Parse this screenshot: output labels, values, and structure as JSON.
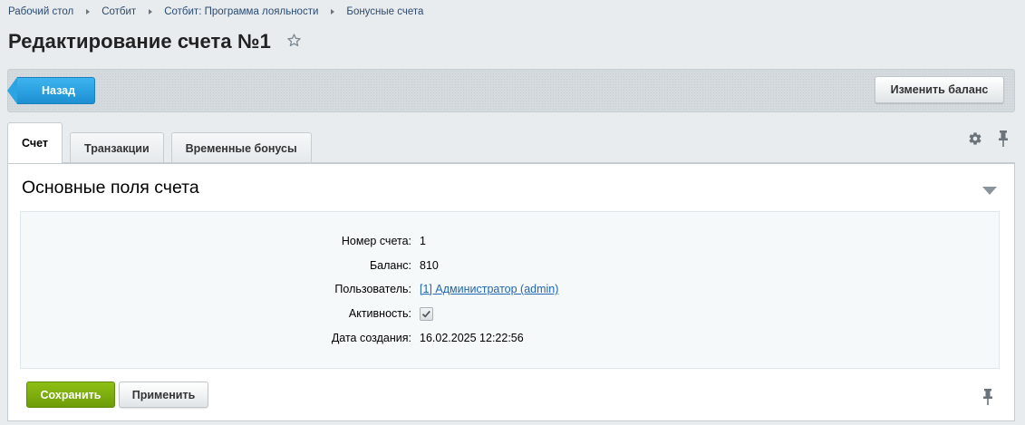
{
  "breadcrumb": [
    {
      "label": "Рабочий стол"
    },
    {
      "label": "Сотбит"
    },
    {
      "label": "Сотбит: Программа лояльности"
    },
    {
      "label": "Бонусные счета"
    }
  ],
  "page": {
    "title": "Редактирование счета №1",
    "favorite_icon": "star-icon"
  },
  "toolbar": {
    "back_label": "Назад",
    "change_balance_label": "Изменить баланс"
  },
  "tabs": [
    {
      "label": "Счет",
      "active": true
    },
    {
      "label": "Транзакции",
      "active": false
    },
    {
      "label": "Временные бонусы",
      "active": false
    }
  ],
  "tab_tools": {
    "settings_icon": "gear-icon",
    "pin_icon": "pin-icon"
  },
  "section": {
    "title": "Основные поля счета",
    "collapse_icon": "chevron-down-icon"
  },
  "fields": {
    "account_number": {
      "label": "Номер счета:",
      "value": "1"
    },
    "balance": {
      "label": "Баланс:",
      "value": "810"
    },
    "user": {
      "label": "Пользователь:",
      "value": "[1] Администратор (admin)"
    },
    "active": {
      "label": "Активность:",
      "checked": true
    },
    "created": {
      "label": "Дата создания:",
      "value": "16.02.2025 12:22:56"
    }
  },
  "actions": {
    "save_label": "Сохранить",
    "apply_label": "Применить"
  },
  "colors": {
    "accent_blue": "#1d8fd2",
    "save_green": "#7aab0d",
    "link": "#2067b0"
  }
}
